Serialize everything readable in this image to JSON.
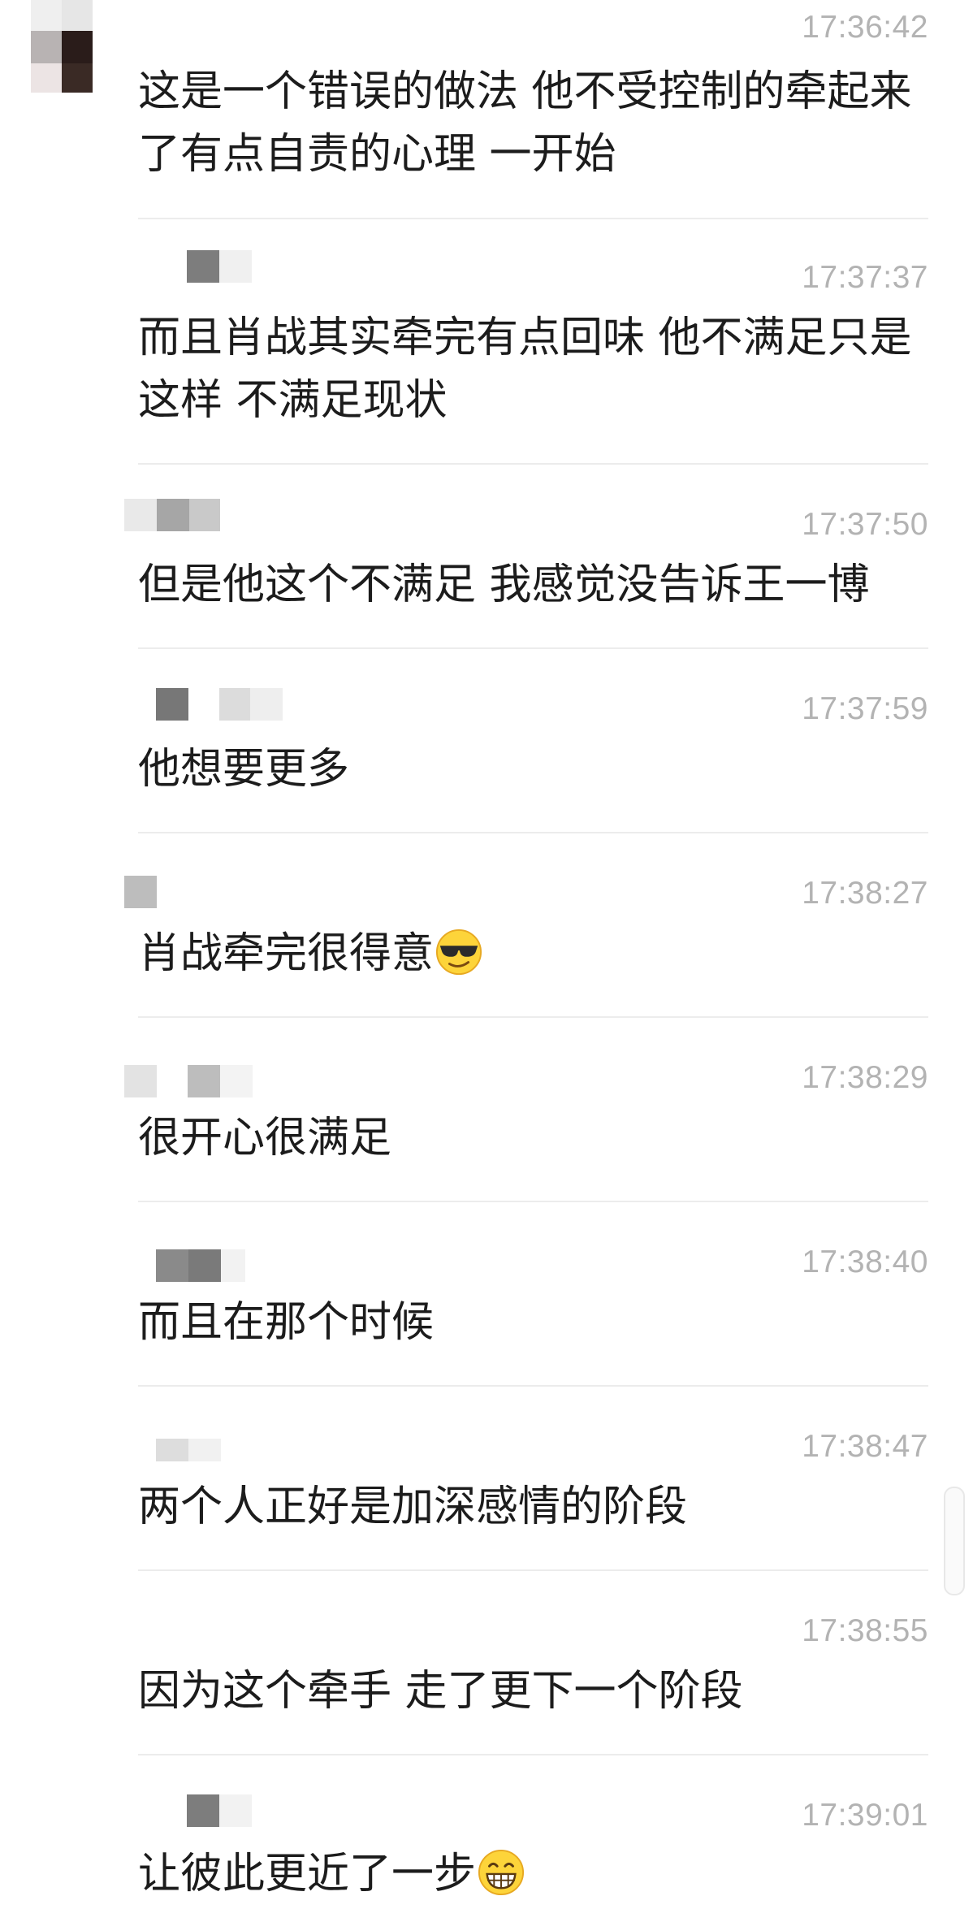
{
  "messages": [
    {
      "time": "17:36:42",
      "text": "这是一个错误的做法 他不受控制的牵起来\n了有点自责的心理 一开始",
      "emoji": ""
    },
    {
      "time": "17:37:37",
      "text": "而且肖战其实牵完有点回味 他不满足只是\n这样 不满足现状",
      "emoji": ""
    },
    {
      "time": "17:37:50",
      "text": "但是他这个不满足 我感觉没告诉王一博",
      "emoji": ""
    },
    {
      "time": "17:37:59",
      "text": "他想要更多",
      "emoji": ""
    },
    {
      "time": "17:38:27",
      "text": "肖战牵完很得意",
      "emoji": "sunglasses-emoji"
    },
    {
      "time": "17:38:29",
      "text": "很开心很满足",
      "emoji": ""
    },
    {
      "time": "17:38:40",
      "text": "而且在那个时候",
      "emoji": ""
    },
    {
      "time": "17:38:47",
      "text": "两个人正好是加深感情的阶段",
      "emoji": ""
    },
    {
      "time": "17:38:55",
      "text": "因为这个牵手 走了更下一个阶段",
      "emoji": ""
    },
    {
      "time": "17:39:01",
      "text": "让彼此更近了一步",
      "emoji": "grin-emoji"
    }
  ],
  "colors": {
    "text": "#1c1c1c",
    "time": "#b3b3b3",
    "divider": "#ececec",
    "background": "#ffffff"
  }
}
